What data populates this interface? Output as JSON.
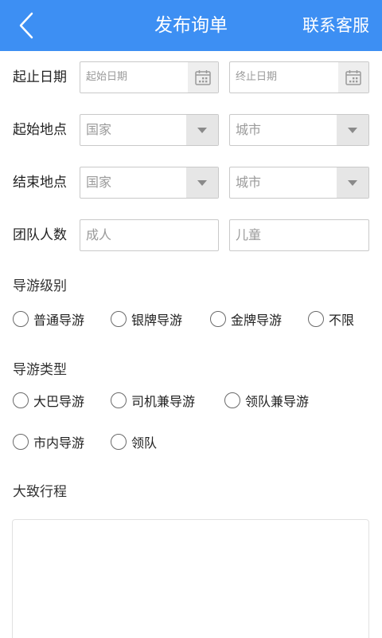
{
  "header": {
    "title": "发布询单",
    "action_label": "联系客服",
    "bg_color": "#3d8ff3"
  },
  "form": {
    "date_row": {
      "label": "起止日期",
      "start_placeholder": "起始日期",
      "end_placeholder": "终止日期",
      "icon": "calendar-icon"
    },
    "start_location": {
      "label": "起始地点",
      "country_placeholder": "国家",
      "city_placeholder": "城市",
      "icon": "dropdown-arrow-icon"
    },
    "end_location": {
      "label": "结束地点",
      "country_placeholder": "国家",
      "city_placeholder": "城市",
      "icon": "dropdown-arrow-icon"
    },
    "group_size": {
      "label": "团队人数",
      "adult_placeholder": "成人",
      "child_placeholder": "儿童"
    },
    "guide_level": {
      "title": "导游级别",
      "options": [
        "普通导游",
        "银牌导游",
        "金牌导游",
        "不限"
      ]
    },
    "guide_type": {
      "title": "导游类型",
      "options": [
        "大巴导游",
        "司机兼导游",
        "领队兼导游",
        "市内导游",
        "领队"
      ]
    },
    "itinerary": {
      "title": "大致行程"
    }
  }
}
